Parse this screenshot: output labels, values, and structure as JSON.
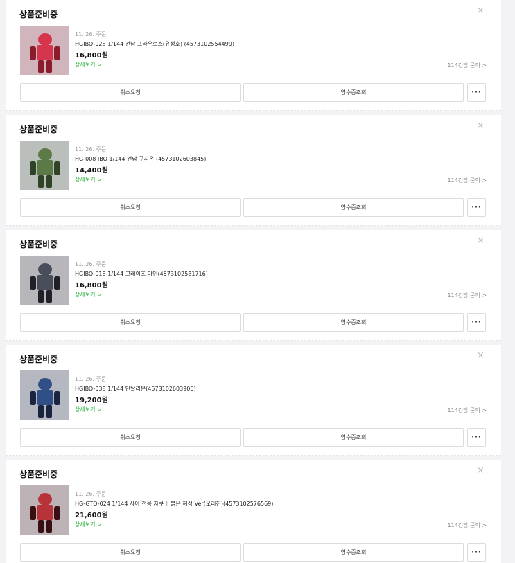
{
  "orders": [
    {
      "status": "상품준비중",
      "close_icon": "×",
      "date": "11. 26. 주문",
      "product_name": "HGIBO-028 1/144 건담 프라우로스(유성호) (4573102554499)",
      "price": "16,800원",
      "detail_link": "상세보기 >",
      "inquiry_link": "114건담 문의 >",
      "cancel_label": "취소요청",
      "receipt_label": "영수증조회",
      "more_label": "···",
      "thumb_colors": [
        "#d6354e",
        "#8a1c2c"
      ]
    },
    {
      "status": "상품준비중",
      "close_icon": "×",
      "date": "11. 26. 주문",
      "product_name": "HG-008 IBO 1/144 건담 구시온 (4573102603845)",
      "price": "14,400원",
      "detail_link": "상세보기 >",
      "inquiry_link": "114건담 문의 >",
      "cancel_label": "취소요청",
      "receipt_label": "영수증조회",
      "more_label": "···",
      "thumb_colors": [
        "#5b7a45",
        "#2f4326"
      ]
    },
    {
      "status": "상품준비중",
      "close_icon": "×",
      "date": "11. 26. 주문",
      "product_name": "HGIBO-018 1/144 그레이즈 아인(4573102581716)",
      "price": "16,800원",
      "detail_link": "상세보기 >",
      "inquiry_link": "114건담 문의 >",
      "cancel_label": "취소요청",
      "receipt_label": "영수증조회",
      "more_label": "···",
      "thumb_colors": [
        "#4a4d5a",
        "#1f2028"
      ]
    },
    {
      "status": "상품준비중",
      "close_icon": "×",
      "date": "11. 26. 주문",
      "product_name": "HGIBO-038 1/144 단탈리온(4573102603906)",
      "price": "19,200원",
      "detail_link": "상세보기 >",
      "inquiry_link": "114건담 문의 >",
      "cancel_label": "취소요청",
      "receipt_label": "영수증조회",
      "more_label": "···",
      "thumb_colors": [
        "#2f4f86",
        "#1a2440"
      ]
    },
    {
      "status": "상품준비중",
      "close_icon": "×",
      "date": "11. 26. 주문",
      "product_name": "HG-GTO-024 1/144 샤아 전용 자쿠 II 붉은 혜성 Ver(오리진)(4573102576569)",
      "price": "21,600원",
      "detail_link": "상세보기 >",
      "inquiry_link": "114건담 문의 >",
      "cancel_label": "취소요청",
      "receipt_label": "영수증조회",
      "more_label": "···",
      "thumb_colors": [
        "#b8323a",
        "#3a0f12"
      ]
    }
  ]
}
